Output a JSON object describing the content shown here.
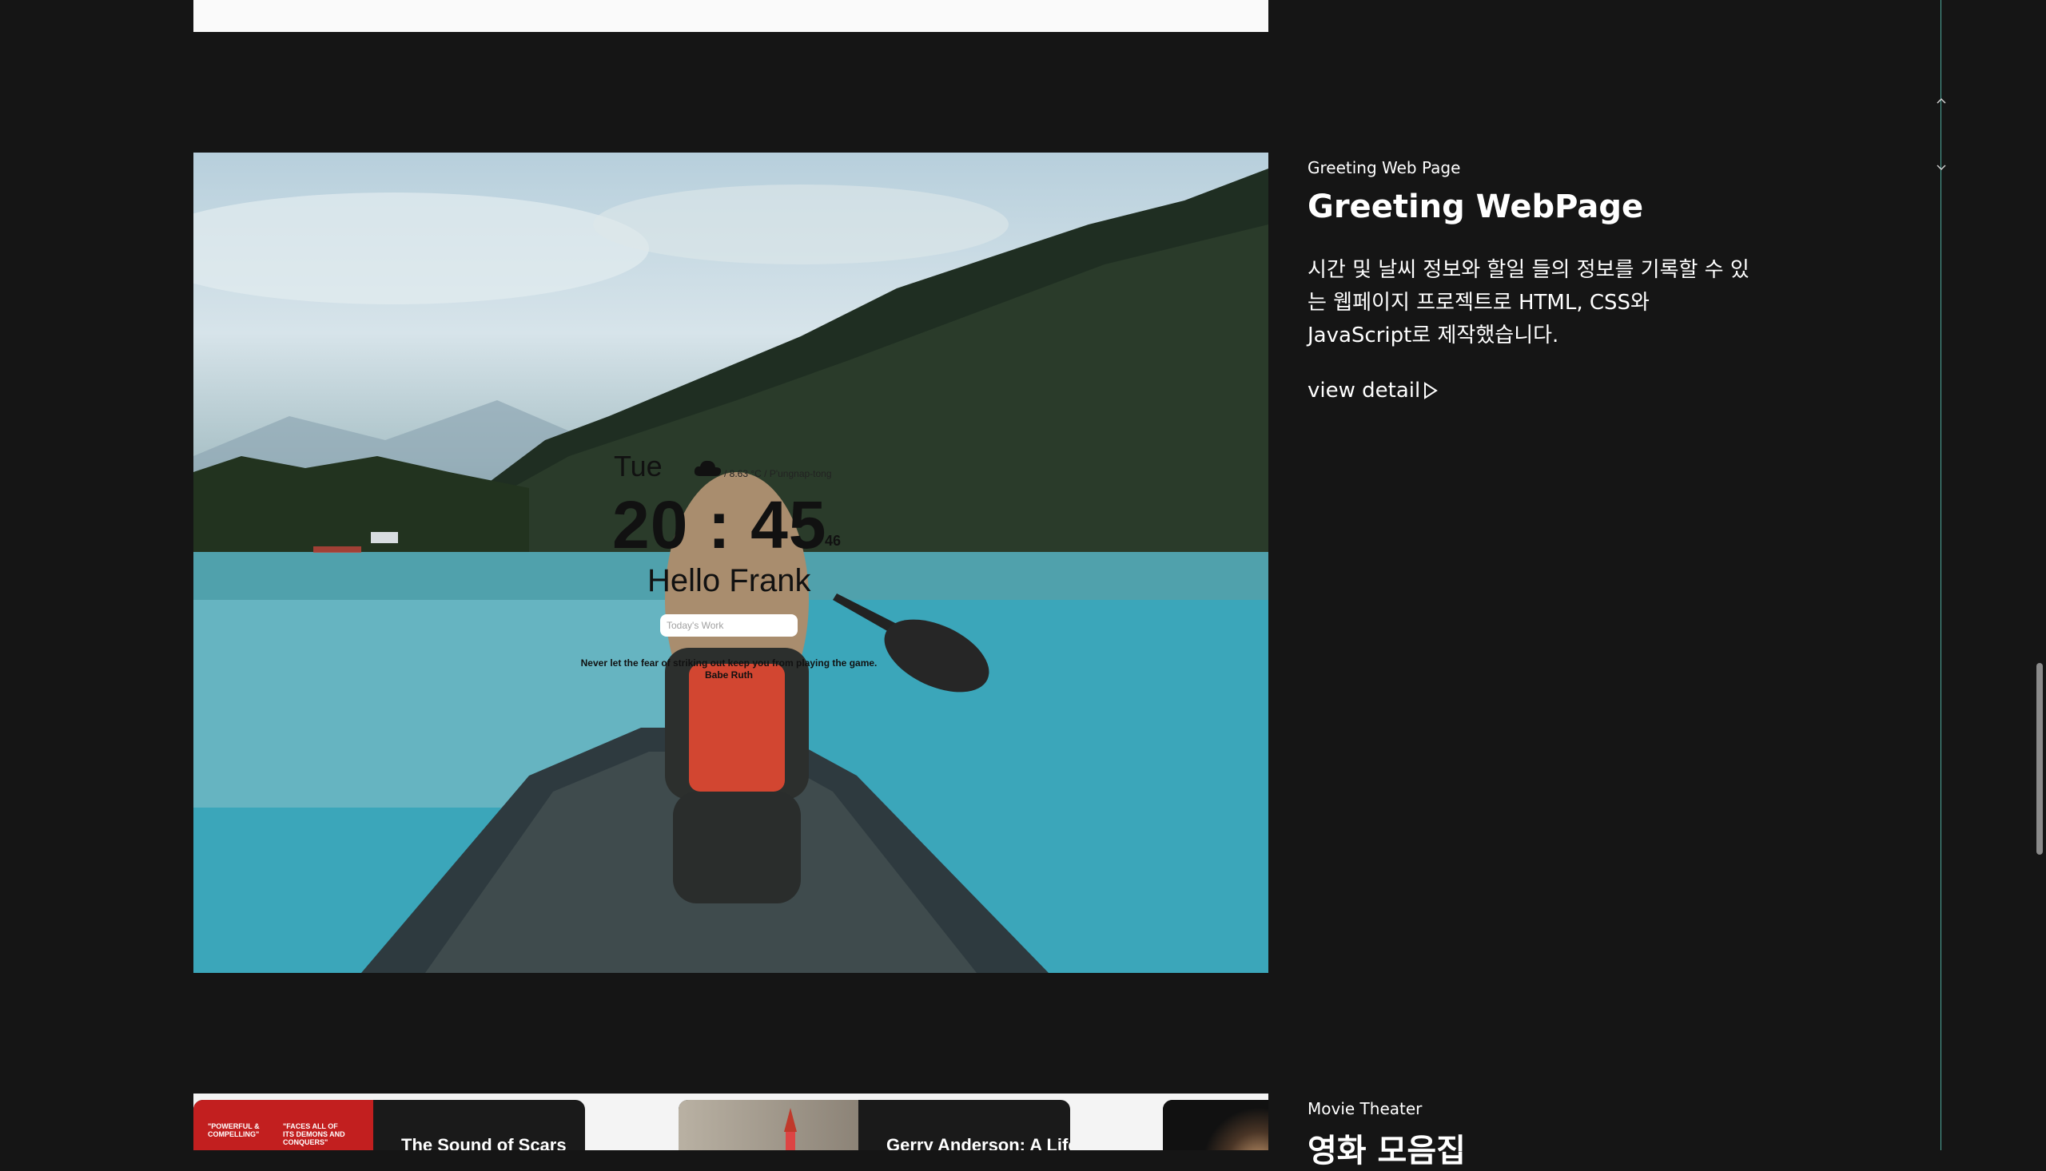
{
  "greeting_project": {
    "category": "Greeting Web Page",
    "title": "Greeting WebPage",
    "description": "시간 및 날씨 정보와 할일 들의 정보를 기록할 수 있는 웹페이지 프로젝트로 HTML, CSS와 JavaScript로 제작했습니다.",
    "view_detail": "view detail",
    "preview": {
      "day": "Tue",
      "weather": "/ 8.63 °C / P'ungnap-tong",
      "weather_icon": "cloud-icon",
      "time": "20 : 45",
      "seconds": "46",
      "greeting": "Hello Frank",
      "todo_placeholder": "Today's Work",
      "quote": "Never let the fear of striking out keep you from playing the game.",
      "quote_author": "Babe Ruth"
    }
  },
  "movie_project": {
    "category": "Movie Theater",
    "title": "영화 모음집",
    "cards": [
      {
        "title": "The Sound of Scars",
        "thumb_text_1": "\"POWERFUL & COMPELLING\"",
        "thumb_text_2": "\"FACES ALL OF ITS DEMONS AND CONQUERS\""
      },
      {
        "title": "Gerry Anderson: A Life Uncharted"
      }
    ]
  },
  "nav": {
    "up_icon": "chevron-up-icon",
    "down_icon": "chevron-down-icon"
  },
  "colors": {
    "background": "#151515",
    "timeline": "#4ea79a",
    "text": "#ffffff"
  }
}
